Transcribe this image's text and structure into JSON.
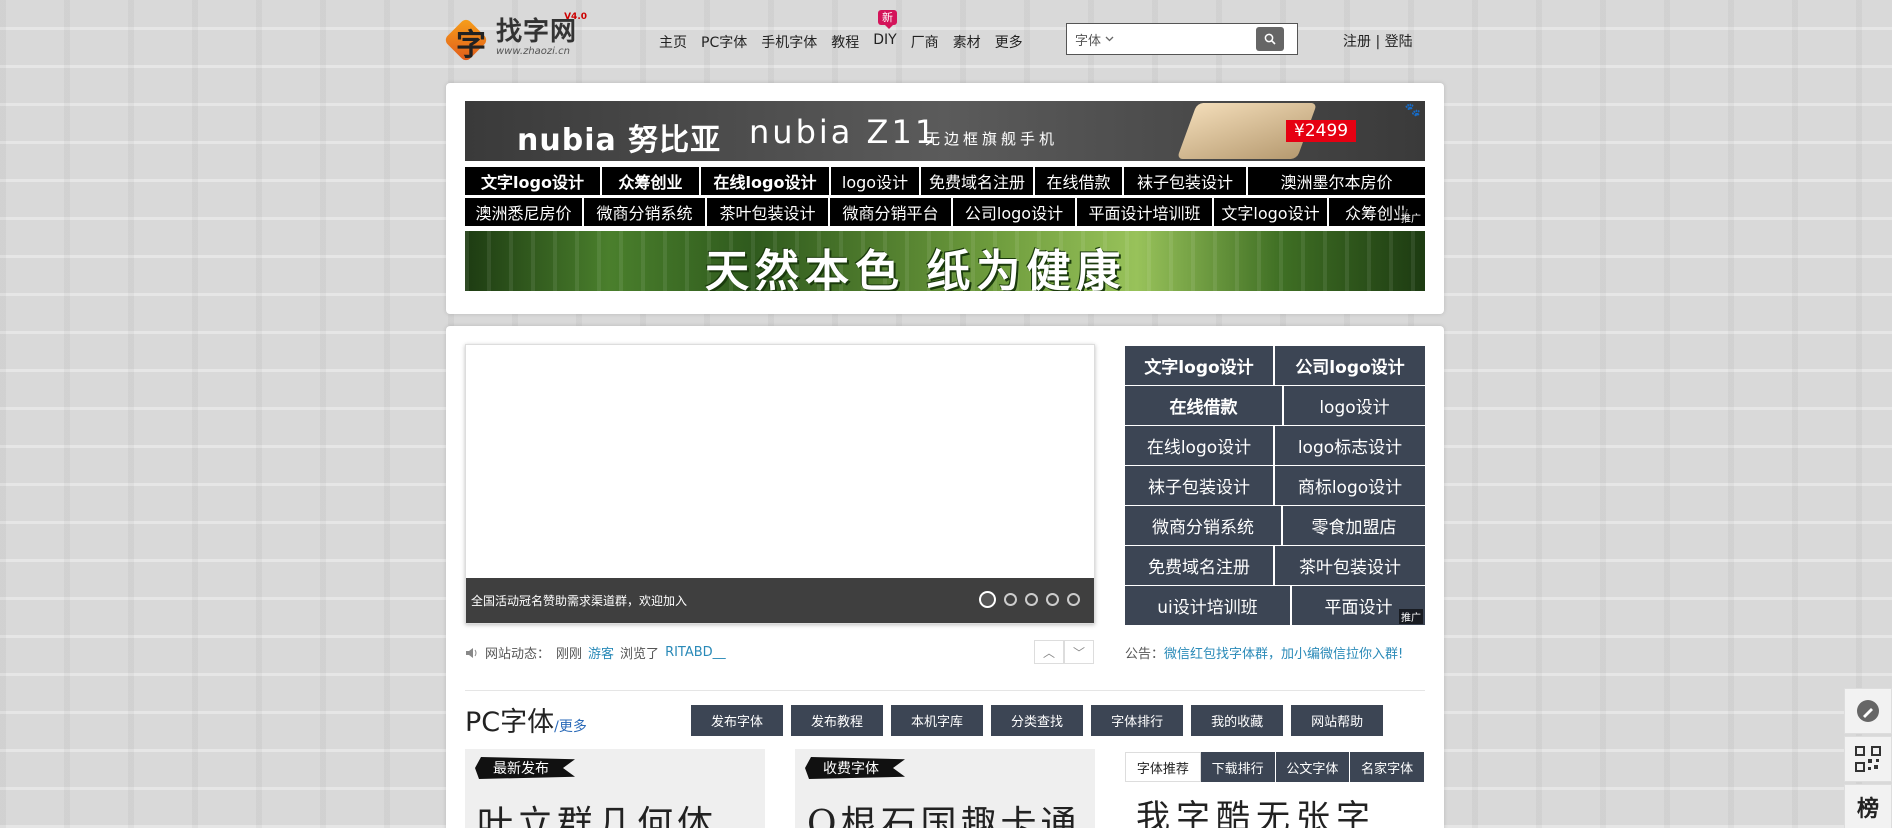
{
  "site": {
    "logo_title": "找字网",
    "logo_url": "www.zhaozi.cn",
    "logo_version": "V4.0"
  },
  "topnav": {
    "items": [
      "主页",
      "PC字体",
      "手机字体",
      "教程",
      "DIY",
      "厂商",
      "素材",
      "更多"
    ],
    "new_badge": "新"
  },
  "search": {
    "type": "字体",
    "value": "",
    "placeholder": ""
  },
  "auth": {
    "register": "注册",
    "separator": "|",
    "login": "登陆"
  },
  "phone_ad": {
    "brand": "nubia 努比亚",
    "model": "nubia Z11",
    "slogan": "无边框旗舰手机",
    "price": "¥2499"
  },
  "link_row_1": [
    "文字logo设计",
    "众筹创业",
    "在线logo设计",
    "logo设计",
    "免费域名注册",
    "在线借款",
    "袜子包装设计",
    "澳洲墨尔本房价"
  ],
  "link_row_2": [
    "澳洲悉尼房价",
    "微商分销系统",
    "茶叶包装设计",
    "微商分销平台",
    "公司logo设计",
    "平面设计培训班",
    "文字logo设计",
    "众筹创业"
  ],
  "tui_label": "推广",
  "bamboo_ad": {
    "slogan": "天然本色  纸为健康"
  },
  "slider": {
    "caption": "全国活动冠名赞助需求渠道群，欢迎加入",
    "slides": 5,
    "active": 1
  },
  "side_links": [
    [
      "文字logo设计",
      "公司logo设计"
    ],
    [
      "在线借款",
      "logo设计"
    ],
    [
      "在线logo设计",
      "logo标志设计"
    ],
    [
      "袜子包装设计",
      "商标logo设计"
    ],
    [
      "微商分销系统",
      "零食加盟店"
    ],
    [
      "免费域名注册",
      "茶叶包装设计"
    ],
    [
      "ui设计培训班",
      "平面设计"
    ]
  ],
  "news": {
    "label": "网站动态：",
    "time": "刚刚",
    "user": "游客",
    "action": "浏览了",
    "item": "RITABD__"
  },
  "notice": {
    "label": "公告：",
    "text": "微信红包找字体群，加小编微信拉你入群!"
  },
  "pc_section": {
    "title": "PC字体",
    "more": "/更多",
    "toolbar": [
      "发布字体",
      "发布教程",
      "本机字库",
      "分类查找",
      "字体排行",
      "我的收藏",
      "网站帮助"
    ]
  },
  "panels": {
    "latest": {
      "tag": "最新发布",
      "sample": "叶立群几何体"
    },
    "paid": {
      "tag": "收费字体",
      "sample": "Q根石国趣卡通"
    }
  },
  "font_tabs": [
    "字体推荐",
    "下载排行",
    "公文字体",
    "名家字体"
  ],
  "rank_sample": "我字酷无张字",
  "float_tools": {
    "rank_label": "榜"
  }
}
